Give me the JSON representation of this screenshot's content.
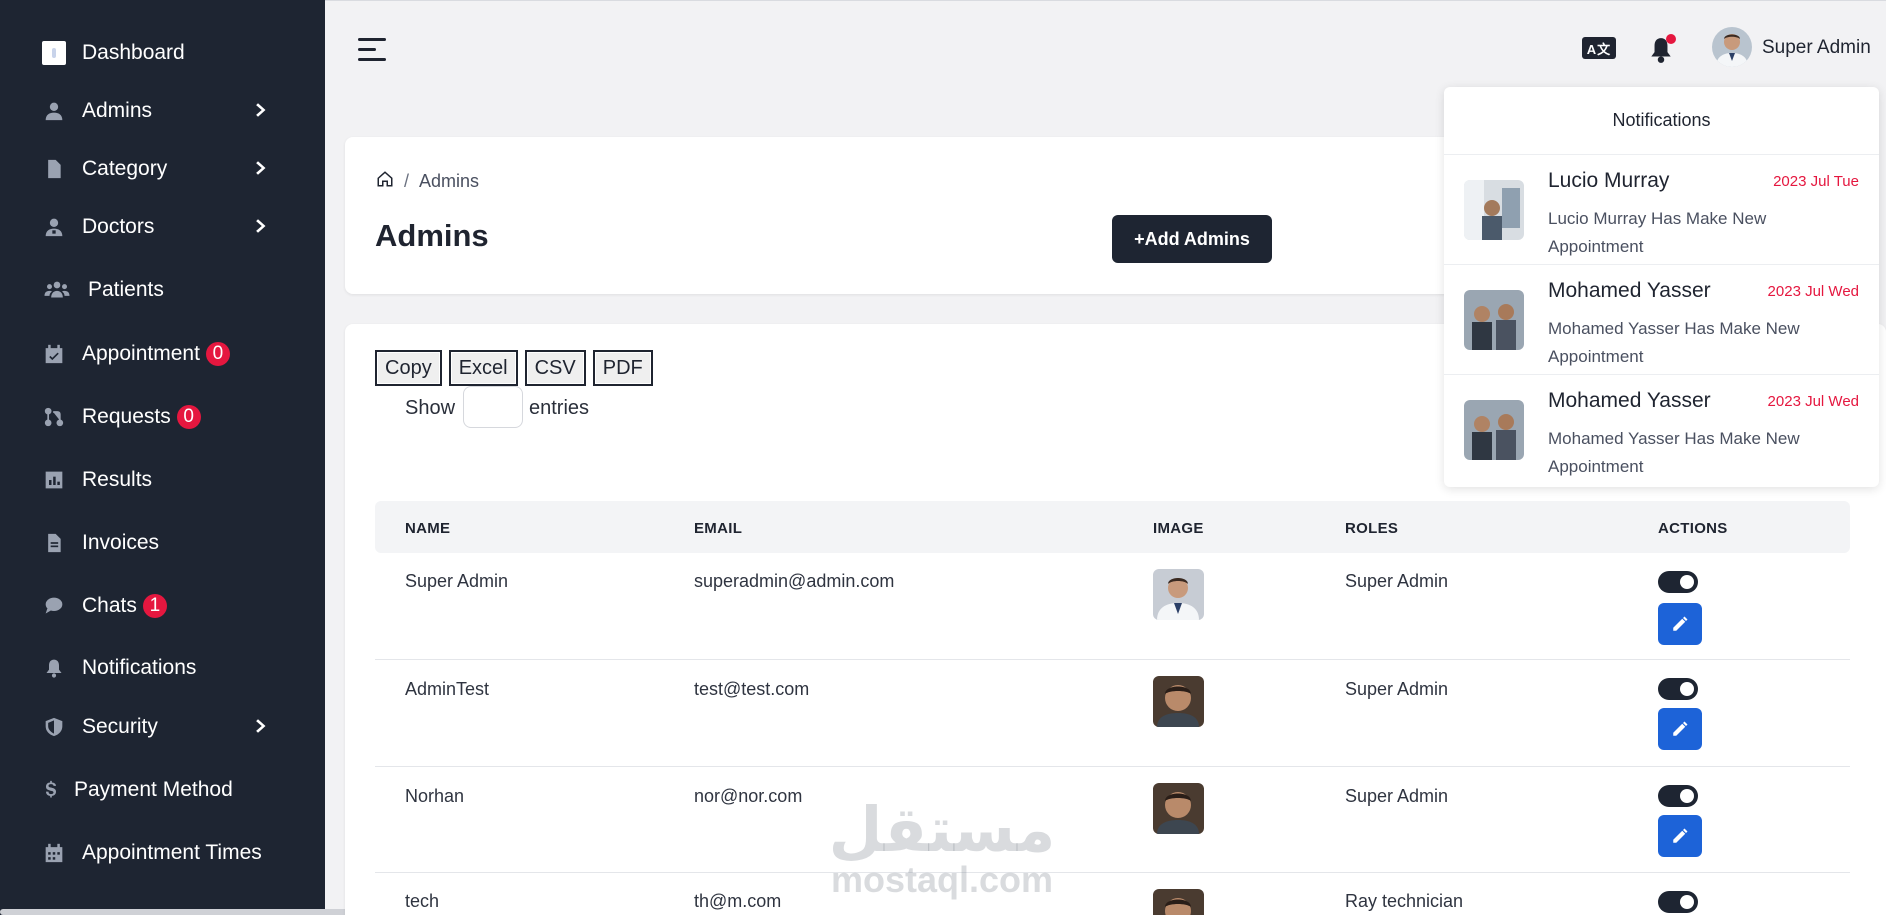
{
  "sidebar": {
    "items": [
      {
        "label": "Dashboard",
        "icon": "dashboard-logo-icon",
        "chevron": false,
        "badge": ""
      },
      {
        "label": "Admins",
        "icon": "user-icon",
        "chevron": true,
        "badge": ""
      },
      {
        "label": "Category",
        "icon": "file-icon",
        "chevron": true,
        "badge": ""
      },
      {
        "label": "Doctors",
        "icon": "doctor-icon",
        "chevron": true,
        "badge": ""
      },
      {
        "label": "Patients",
        "icon": "users-icon",
        "chevron": false,
        "badge": ""
      },
      {
        "label": "Appointment",
        "icon": "calendar-check-icon",
        "chevron": false,
        "badge": "0"
      },
      {
        "label": "Requests",
        "icon": "git-pull-request-icon",
        "chevron": false,
        "badge": "0"
      },
      {
        "label": "Results",
        "icon": "chart-bar-icon",
        "chevron": false,
        "badge": ""
      },
      {
        "label": "Invoices",
        "icon": "invoice-icon",
        "chevron": false,
        "badge": ""
      },
      {
        "label": "Chats",
        "icon": "chat-icon",
        "chevron": false,
        "badge": "1"
      },
      {
        "label": "Notifications",
        "icon": "bell-icon",
        "chevron": false,
        "badge": ""
      },
      {
        "label": "Security",
        "icon": "shield-icon",
        "chevron": true,
        "badge": ""
      },
      {
        "label": "Payment Method",
        "icon": "dollar-icon",
        "chevron": false,
        "badge": ""
      },
      {
        "label": "Appointment Times",
        "icon": "calendar-icon",
        "chevron": false,
        "badge": ""
      }
    ]
  },
  "topbar": {
    "language_icon_label": "A文",
    "user_name": "Super Admin"
  },
  "header": {
    "breadcrumb_current": "Admins",
    "breadcrumb_sep": "/",
    "title": "Admins",
    "add_button": "+Add Admins"
  },
  "table_controls": {
    "buttons": [
      "Copy",
      "Excel",
      "CSV",
      "PDF"
    ],
    "show_label": "Show",
    "entries_label": "entries"
  },
  "table": {
    "columns": [
      "NAME",
      "EMAIL",
      "IMAGE",
      "ROLES",
      "ACTIONS"
    ],
    "rows": [
      {
        "name": "Super Admin",
        "email": "superadmin@admin.com",
        "role": "Super Admin"
      },
      {
        "name": "AdminTest",
        "email": "test@test.com",
        "role": "Super Admin"
      },
      {
        "name": "Norhan",
        "email": "nor@nor.com",
        "role": "Super Admin"
      },
      {
        "name": "tech",
        "email": "th@m.com",
        "role": "Ray technician"
      }
    ]
  },
  "notifications": {
    "title": "Notifications",
    "items": [
      {
        "name": "Lucio Murray",
        "date": "2023 Jul Tue",
        "message": "Lucio Murray Has Make New Appointment"
      },
      {
        "name": "Mohamed Yasser",
        "date": "2023 Jul Wed",
        "message": "Mohamed Yasser Has Make New Appointment"
      },
      {
        "name": "Mohamed Yasser",
        "date": "2023 Jul Wed",
        "message": "Mohamed Yasser Has Make New Appointment"
      }
    ]
  },
  "watermark": {
    "arabic": "مستقل",
    "latin": "mostaql.com"
  },
  "colors": {
    "sidebar_bg": "#1e2532",
    "badge_red": "#e5173f",
    "edit_blue": "#1d63d8",
    "page_bg": "#f2f2f4"
  }
}
